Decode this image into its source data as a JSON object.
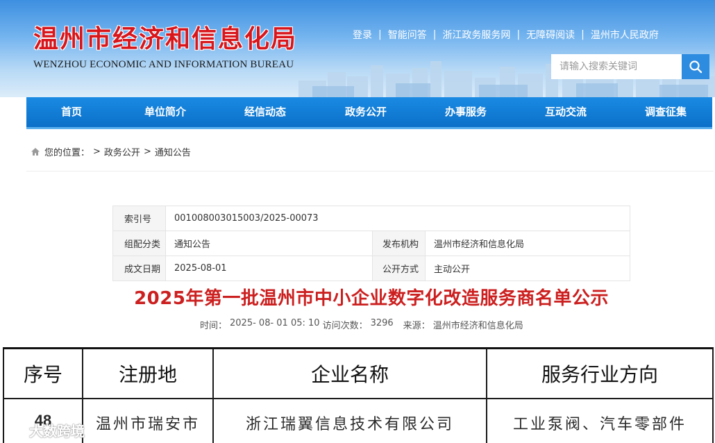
{
  "header": {
    "logo_cn": "温州市经济和信息化局",
    "logo_en": "WENZHOU ECONOMIC AND INFORMATION BUREAU",
    "links": [
      "登录",
      "智能问答",
      "浙江政务服务网",
      "无障碍阅读",
      "温州市人民政府"
    ],
    "search_placeholder": "请输入搜索关键词",
    "search_icon": "search-icon",
    "accent": "#2d8be0",
    "logo_color": "#d8161b"
  },
  "nav": {
    "items": [
      "首页",
      "单位简介",
      "经信动态",
      "政务公开",
      "办事服务",
      "互动交流",
      "调查征集"
    ],
    "bg": "#0f7ad4"
  },
  "breadcrumb": {
    "icon": "home-icon",
    "label": "您的位置：",
    "items": [
      "政务公开",
      "通知公告"
    ]
  },
  "meta": {
    "index_label": "索引号",
    "index_value": "001008003015003/2025-00073",
    "category_label": "组配分类",
    "category_value": "通知公告",
    "publisher_label": "发布机构",
    "publisher_value": "温州市经济和信息化局",
    "date_label": "成文日期",
    "date_value": "2025-08-01",
    "open_label": "公开方式",
    "open_value": "主动公开"
  },
  "article": {
    "title": "2025年第一批温州市中小企业数字化改造服务商名单公示",
    "title_color": "#cc1f1f",
    "time_label": "时间：",
    "time_value": "2025- 08- 01 05: 10",
    "views_label": "访问次数：",
    "views_value": "3296",
    "source_label": "来源：",
    "source_value": "温州市经济和信息化局"
  },
  "list": {
    "headers": [
      "序号",
      "注册地",
      "企业名称",
      "服务行业方向"
    ],
    "rows": [
      [
        "48",
        "温州市瑞安市",
        "浙江瑞翼信息技术有限公司",
        "工业泵阀、汽车零部件"
      ]
    ]
  },
  "watermark": {
    "icon": "wechat-icon",
    "text": "大数跨境"
  }
}
